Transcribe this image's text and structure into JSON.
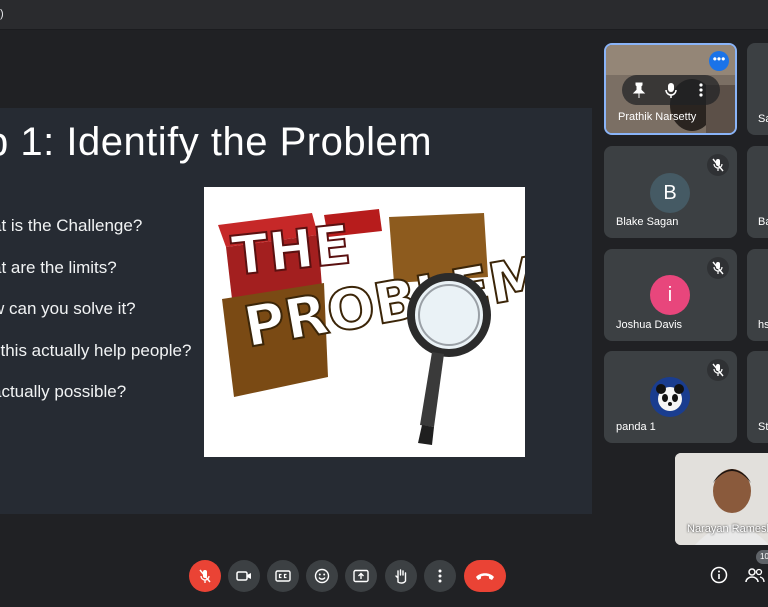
{
  "window": {
    "title": ")"
  },
  "slide": {
    "title": "p 1: Identify the Problem",
    "bullets": [
      "at is the Challenge?",
      "at are the limits?",
      "w can you solve it?",
      "l this actually help people?",
      "actually possible?"
    ],
    "image": {
      "line1": "THE",
      "line2": "PROBLEM"
    }
  },
  "participants": {
    "self_tile": {
      "name": "Prathik Narsetty",
      "menu_glyph": "•••"
    },
    "tiles": [
      {
        "name": "Blake Sagan",
        "initial": "B",
        "color": "#455a64"
      },
      {
        "name": "Joshua Davis",
        "initial": "i",
        "color": "#e8467c"
      },
      {
        "name": "panda 1",
        "initial": "",
        "color": "#1a3d8f"
      }
    ],
    "right_edge": [
      "Sa",
      "Ba",
      "hs",
      "St"
    ],
    "presenter_pip": {
      "name": "Narayan Ramesh"
    },
    "count_badge": "10"
  },
  "controls": {
    "accent_red": "#ea4335",
    "icons": [
      "mic-off-icon",
      "camera-icon",
      "captions-icon",
      "emoji-icon",
      "present-icon",
      "raise-hand-icon",
      "more-options-icon",
      "end-call-icon",
      "info-icon",
      "people-icon"
    ]
  }
}
